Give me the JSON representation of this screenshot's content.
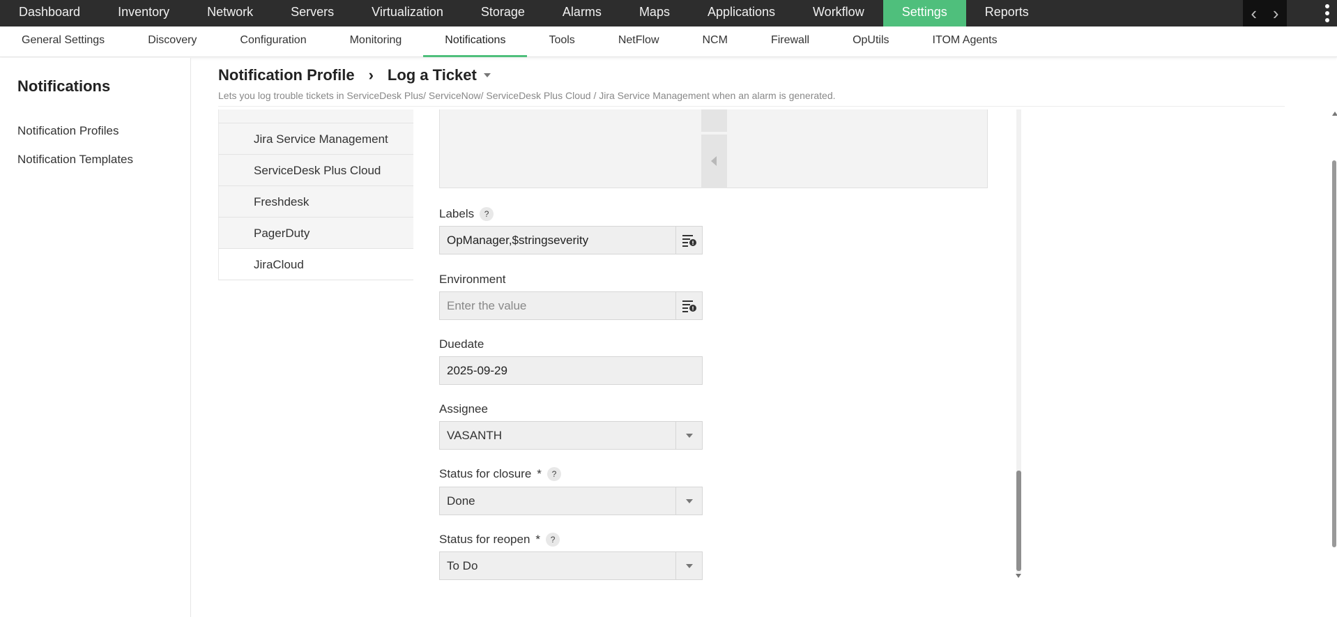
{
  "top_nav": {
    "items": [
      "Dashboard",
      "Inventory",
      "Network",
      "Servers",
      "Virtualization",
      "Storage",
      "Alarms",
      "Maps",
      "Applications",
      "Workflow",
      "Settings",
      "Reports"
    ],
    "active": "Settings",
    "prev_arrow": "‹",
    "next_arrow": "›",
    "accent_color": "#4fbf7c"
  },
  "sub_nav": {
    "items": [
      "General Settings",
      "Discovery",
      "Configuration",
      "Monitoring",
      "Notifications",
      "Tools",
      "NetFlow",
      "NCM",
      "Firewall",
      "OpUtils",
      "ITOM Agents"
    ],
    "active": "Notifications"
  },
  "sidebar": {
    "title": "Notifications",
    "links": [
      "Notification Profiles",
      "Notification Templates"
    ]
  },
  "header": {
    "breadcrumb_parent": "Notification Profile",
    "breadcrumb_separator": "›",
    "breadcrumb_current": "Log a Ticket",
    "description": "Lets you log trouble tickets in ServiceDesk Plus/ ServiceNow/ ServiceDesk Plus Cloud / Jira Service Management when an alarm is generated."
  },
  "ticket_types": [
    "Jira Service Management",
    "ServiceDesk Plus Cloud",
    "Freshdesk",
    "PagerDuty",
    "JiraCloud"
  ],
  "form": {
    "labels_label": "Labels",
    "labels_value": "OpManager,$stringseverity",
    "environment_label": "Environment",
    "environment_placeholder": "Enter the value",
    "duedate_label": "Duedate",
    "duedate_value": "2025-09-29",
    "assignee_label": "Assignee",
    "assignee_value": "VASANTH",
    "closure_label": "Status for closure",
    "closure_value": "Done",
    "reopen_label": "Status for reopen",
    "reopen_value": "To Do",
    "required_mark": "*",
    "help_mark": "?"
  }
}
